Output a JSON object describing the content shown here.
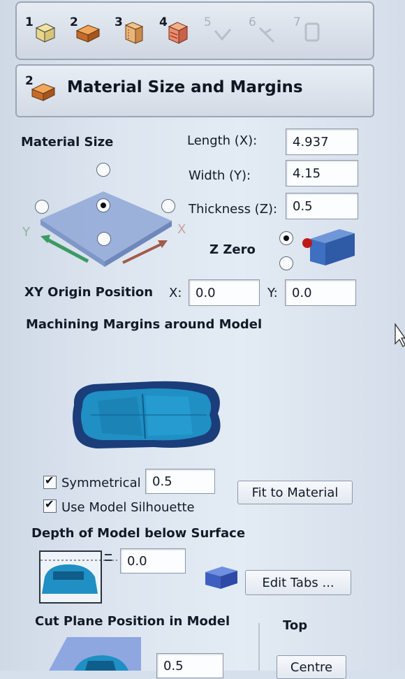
{
  "toolbar": {
    "steps": [
      {
        "number": "1",
        "icon": "material-box-icon"
      },
      {
        "number": "2",
        "icon": "material-block-icon"
      },
      {
        "number": "3",
        "icon": "slice-icon"
      },
      {
        "number": "4",
        "icon": "hatched-slice-icon"
      },
      {
        "number": "5",
        "icon": "disabled-step-icon"
      },
      {
        "number": "6",
        "icon": "disabled-step-icon"
      },
      {
        "number": "7",
        "icon": "disabled-step-icon"
      }
    ]
  },
  "header": {
    "step_number": "2",
    "title": "Material Size and Margins"
  },
  "material_size": {
    "section_label": "Material Size",
    "length_label": "Length (X):",
    "length_value": "4.937",
    "width_label": "Width (Y):",
    "width_value": "4.15",
    "thickness_label": "Thickness (Z):",
    "thickness_value": "0.5",
    "axis_y": "Y",
    "axis_x": "X"
  },
  "z_zero": {
    "label": "Z Zero"
  },
  "xy_origin": {
    "label": "XY Origin Position",
    "x_label": "X:",
    "x_value": "0.0",
    "y_label": "Y:",
    "y_value": "0.0"
  },
  "margins": {
    "section_label": "Machining Margins around Model",
    "symmetrical_label": "Symmetrical",
    "symmetrical_checked": true,
    "margin_value": "0.5",
    "silhouette_label": "Use Model Silhouette",
    "silhouette_checked": true,
    "fit_button": "Fit to Material"
  },
  "depth": {
    "section_label": "Depth of Model below Surface",
    "value": "0.0",
    "edit_tabs_button": "Edit Tabs ..."
  },
  "cut_plane": {
    "section_label": "Cut Plane Position in Model",
    "top_label": "Top",
    "value": "0.5",
    "centre_button": "Centre"
  },
  "colors": {
    "model_blue": "#1f8fc4",
    "margin_navy": "#1b3d7a",
    "block_blue": "#3f6fc0"
  }
}
